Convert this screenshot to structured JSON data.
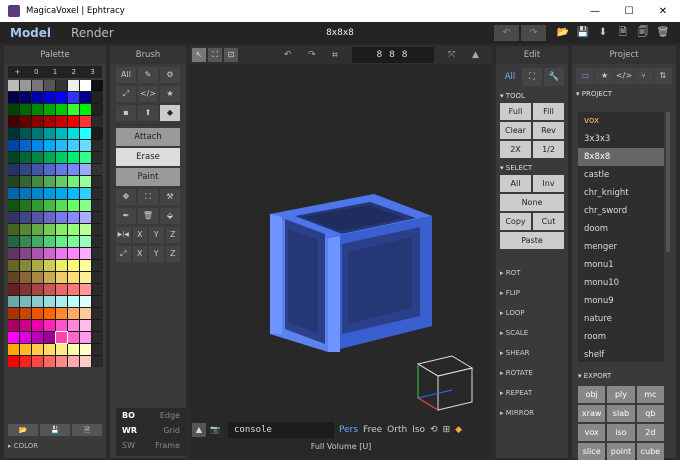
{
  "window": {
    "title": "MagicaVoxel | Ephtracy",
    "controls": [
      "—",
      "☐",
      "✕"
    ]
  },
  "menu": {
    "modes": [
      "Model",
      "Render"
    ],
    "doc_title": "8x8x8",
    "undo": "↶",
    "redo": "↷",
    "file_icons": [
      "📂",
      "💾",
      "⬇",
      "🗎",
      "🗐",
      "🗑"
    ]
  },
  "palette": {
    "title": "Palette",
    "tabs": [
      "+",
      "0",
      "1",
      "2",
      "3"
    ],
    "colors": [
      "#bbbbbb",
      "#999999",
      "#777777",
      "#555555",
      "#333333",
      "#eeeeee",
      "#ffffff",
      "#111111",
      "#000044",
      "#000066",
      "#0000aa",
      "#0000dd",
      "#0000ff",
      "#3333ff",
      "#000088",
      "#222222",
      "#004400",
      "#006600",
      "#008800",
      "#00aa00",
      "#00cc00",
      "#33ff33",
      "#00ee00",
      "#222222",
      "#440000",
      "#660000",
      "#880000",
      "#aa0000",
      "#cc0000",
      "#ee0000",
      "#ff3333",
      "#2a2a2a",
      "#003333",
      "#005555",
      "#007777",
      "#009999",
      "#00bbbb",
      "#00dddd",
      "#22ffff",
      "#1a1a1a",
      "#0044aa",
      "#0066cc",
      "#0088ee",
      "#00aaff",
      "#22bbff",
      "#44ccff",
      "#66ddff",
      "#2a2a2a",
      "#004422",
      "#006633",
      "#008844",
      "#00aa55",
      "#00cc66",
      "#00ee77",
      "#33ff88",
      "#2a2a2a",
      "#223366",
      "#334488",
      "#4455aa",
      "#5566cc",
      "#6677ee",
      "#7788ff",
      "#99aaff",
      "#333333",
      "#224422",
      "#336633",
      "#448844",
      "#55aa55",
      "#66cc66",
      "#77ee77",
      "#99ff99",
      "#2a2a2a",
      "#0066aa",
      "#0077bb",
      "#0088cc",
      "#0099dd",
      "#00aaee",
      "#00bbff",
      "#33ccff",
      "#2a2a2a",
      "#115511",
      "#227722",
      "#339933",
      "#44bb44",
      "#55dd55",
      "#66ff66",
      "#88ff88",
      "#2a2a2a",
      "#333366",
      "#444488",
      "#5555aa",
      "#6666cc",
      "#7777ee",
      "#8888ff",
      "#aaaaff",
      "#2a2a2a",
      "#446622",
      "#558833",
      "#66aa44",
      "#77cc55",
      "#88ee66",
      "#99ff77",
      "#bbff99",
      "#2a2a2a",
      "#226644",
      "#338855",
      "#44aa66",
      "#55cc77",
      "#66ee88",
      "#77ff99",
      "#99ffbb",
      "#2a2a2a",
      "#663366",
      "#884488",
      "#aa55aa",
      "#cc66cc",
      "#ee77ee",
      "#ff88ff",
      "#ffaaff",
      "#2a2a2a",
      "#666622",
      "#888833",
      "#aaaa44",
      "#cccc55",
      "#eeee66",
      "#ffff77",
      "#ffff99",
      "#2a2a2a",
      "#664422",
      "#886633",
      "#aa8844",
      "#ccaa55",
      "#eecc66",
      "#ffdd77",
      "#ffee99",
      "#2a2a2a",
      "#662222",
      "#883333",
      "#aa4444",
      "#cc5555",
      "#ee6666",
      "#ff7777",
      "#ff9999",
      "#2a2a2a",
      "#66aaaa",
      "#77bbbb",
      "#88cccc",
      "#99dddd",
      "#aaeeee",
      "#bbffff",
      "#ddffff",
      "#2a2a2a",
      "#aa3300",
      "#cc4400",
      "#ee5500",
      "#ff6600",
      "#ff8833",
      "#ffaa66",
      "#ffcc99",
      "#2a2a2a",
      "#aa0066",
      "#cc0088",
      "#ee00aa",
      "#ff22bb",
      "#ff55cc",
      "#ff88dd",
      "#ffbbee",
      "#2a2a2a",
      "#ff00ff",
      "#dd00dd",
      "#bb00bb",
      "#990099",
      "#ff44aa",
      "#ff66cc",
      "#ff99ee",
      "#2a2a2a",
      "#ffaa00",
      "#ffbb22",
      "#ffcc44",
      "#ffdd66",
      "#ffee88",
      "#ffffaa",
      "#ffffcc",
      "#2a2a2a",
      "#ff0000",
      "#ff2222",
      "#ff4444",
      "#ff6666",
      "#ff8888",
      "#ffaaaa",
      "#ffcccc",
      "#2a2a2a"
    ],
    "tools": [
      "📂",
      "💾",
      "🗎"
    ],
    "footer": "COLOR"
  },
  "brush": {
    "title": "Brush",
    "type_tabs": [
      "All",
      "✎",
      "⚙"
    ],
    "shape_tools": [
      "⤢",
      "</>",
      "★",
      "▪",
      "⬆",
      "◆"
    ],
    "modes": [
      "Attach",
      "Erase",
      "Paint"
    ],
    "tools": [
      "✥",
      "⛶",
      "⚒",
      "✒",
      "🗑",
      "⬙"
    ],
    "axis_row1": [
      "▶|◀",
      "X",
      "Y",
      "Z"
    ],
    "axis_row2": [
      "⤢",
      "X",
      "Y",
      "Z"
    ]
  },
  "viewport": {
    "dimensions": "8 8 8",
    "console_value": "console",
    "projections": [
      "Pers",
      "Free",
      "Orth",
      "Iso"
    ],
    "active_projection": "Pers",
    "status": "Full Volume [U]",
    "overlay": [
      {
        "on": "BO",
        "off": "Edge"
      },
      {
        "on": "WR",
        "off": "Grid"
      },
      {
        "on": "SW",
        "off": "Frame"
      }
    ]
  },
  "edit": {
    "title": "Edit",
    "tabs": [
      "All",
      "⛶",
      "🔧"
    ],
    "tool_section": "TOOL",
    "tool_buttons": [
      "Full",
      "Fill",
      "Clear",
      "Rev",
      "2X",
      "1/2"
    ],
    "select_section": "SELECT",
    "select_buttons": [
      "All",
      "Inv"
    ],
    "none_button": "None",
    "clip_buttons": [
      "Copy",
      "Cut"
    ],
    "paste_button": "Paste",
    "collapsed": [
      "ROT",
      "FLIP",
      "LOOP",
      "SCALE",
      "SHEAR",
      "ROTATE",
      "REPEAT",
      "MIRROR"
    ]
  },
  "project": {
    "title": "Project",
    "tabs": [
      "▭",
      "★",
      "</>",
      "⑂",
      "⇅"
    ],
    "section": "PROJECT",
    "folder": "vox",
    "items": [
      "3x3x3",
      "8x8x8",
      "castle",
      "chr_knight",
      "chr_sword",
      "doom",
      "menger",
      "monu1",
      "monu10",
      "monu9",
      "nature",
      "room",
      "shelf"
    ],
    "selected": "8x8x8",
    "export_section": "EXPORT",
    "export": [
      "obj",
      "ply",
      "mc",
      "xraw",
      "slab",
      "qb",
      "vox",
      "iso",
      "2d",
      "slice",
      "point",
      "cube"
    ]
  },
  "colors": {
    "cube": "#5b83f0",
    "accent": "#6aa6ff",
    "folder": "#f2c94c"
  }
}
